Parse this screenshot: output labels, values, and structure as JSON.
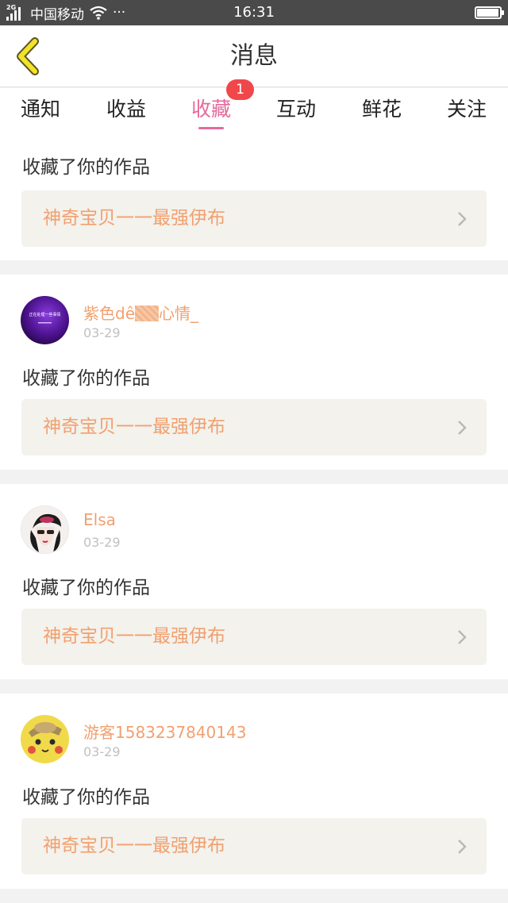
{
  "status_bar": {
    "network_tag": "2G",
    "carrier": "中国移动",
    "wifi_icon": "wifi-icon",
    "more": "···",
    "time": "16:31",
    "battery_level": 0.95
  },
  "header": {
    "back_icon": "chevron-left-icon",
    "title": "消息"
  },
  "tabs": {
    "items": [
      {
        "label": "通知"
      },
      {
        "label": "收益"
      },
      {
        "label": "收藏",
        "active": true
      },
      {
        "label": "互动"
      },
      {
        "label": "鲜花"
      },
      {
        "label": "关注"
      }
    ],
    "badge": "1"
  },
  "feed": [
    {
      "action": "收藏了你的作品",
      "work_title": "神奇宝贝一一最强伊布"
    },
    {
      "user": {
        "name_prefix": "紫色dê",
        "name_suffix": "心情_",
        "date": "03-29",
        "avatar_icon": "purple-galaxy-avatar",
        "avatar_text": "正在处理一些事情"
      },
      "action": "收藏了你的作品",
      "work_title": "神奇宝贝一一最强伊布"
    },
    {
      "user": {
        "name": "Elsa",
        "date": "03-29",
        "avatar_icon": "girl-with-hat-avatar"
      },
      "action": "收藏了你的作品",
      "work_title": "神奇宝贝一一最强伊布"
    },
    {
      "user": {
        "name": "游客1583237840143",
        "date": "03-29",
        "avatar_icon": "yellow-pikachu-avatar"
      },
      "action": "收藏了你的作品",
      "work_title": "神奇宝贝一一最强伊布"
    }
  ],
  "colors": {
    "accent_pink": "#e56a9b",
    "orange_text": "#f1a070",
    "badge_red": "#f0474b",
    "work_bg": "#f3f2ec"
  }
}
